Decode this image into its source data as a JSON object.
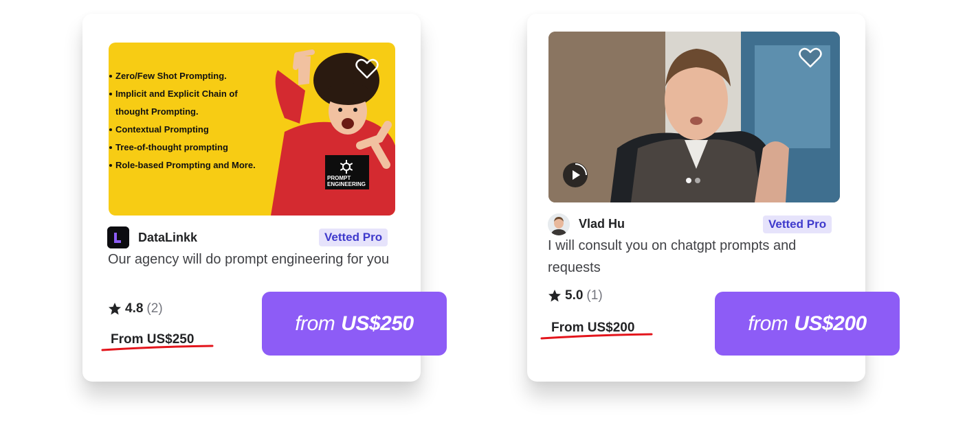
{
  "cards": [
    {
      "thumbnail_bullets": [
        "Zero/Few Shot Prompting.",
        "Implicit and Explicit Chain of thought Prompting.",
        "Contextual Prompting",
        "Tree-of-thought prompting",
        "Role-based Prompting and More."
      ],
      "logo_text": "PROMPT ENGINEERING",
      "seller_name": "DataLinkk",
      "badge": "Vetted Pro",
      "title": "Our agency will do prompt engineering for you",
      "rating": "4.8",
      "rating_count": "(2)",
      "price": "From US$250"
    },
    {
      "seller_name": "Vlad Hu",
      "badge": "Vetted Pro",
      "title": "I will consult you on chatgpt prompts and requests",
      "rating": "5.0",
      "rating_count": "(1)",
      "price": "From US$200",
      "video_icon": "play-icon",
      "carousel_dots": 2
    }
  ],
  "callouts": [
    {
      "from": "from",
      "amount": "US$250"
    },
    {
      "from": "from",
      "amount": "US$200"
    }
  ],
  "colors": {
    "accent_purple": "#8d5cf6",
    "badge_bg": "#e6e3fb",
    "badge_text": "#3f3acc",
    "underline_red": "#e3141b",
    "thumbnail_yellow": "#f7cc14"
  }
}
